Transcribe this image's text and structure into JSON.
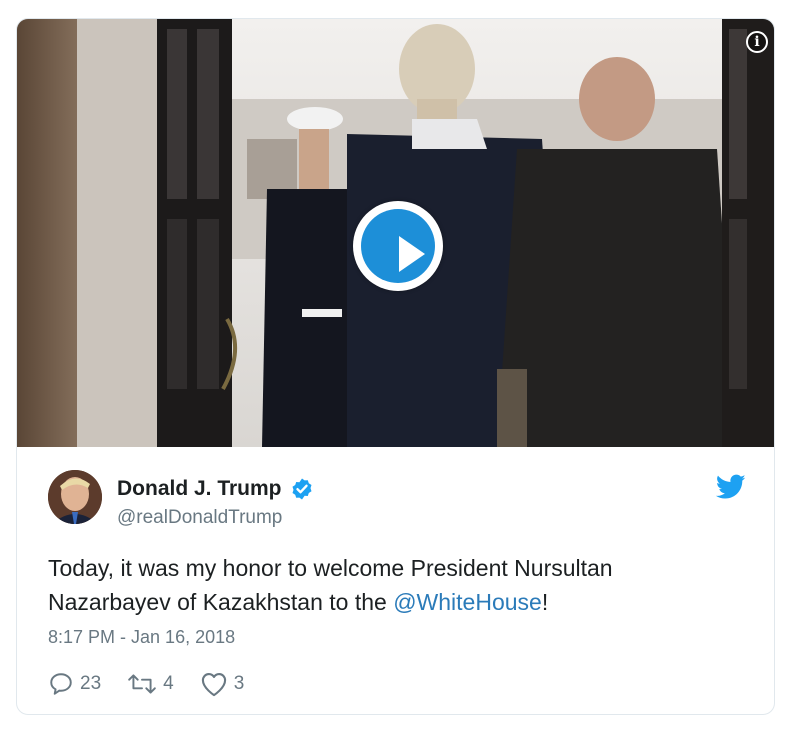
{
  "media": {
    "info_glyph": "i",
    "play_icon": "play-icon",
    "play_color": "#1d8fd8"
  },
  "tweet": {
    "display_name": "Donald J. Trump",
    "handle": "@realDonaldTrump",
    "verified_icon": "verified-badge-icon",
    "verified_color": "#1da1f2",
    "brand_icon": "twitter-bird-icon",
    "brand_color": "#1da1f2",
    "text_before": "Today, it was my honor to welcome President Nursultan Nazarbayev of Kazakhstan to the ",
    "mention": "@WhiteHouse",
    "text_after": "!",
    "timestamp": "8:17 PM - Jan 16, 2018"
  },
  "actions": {
    "reply_count": "23",
    "retweet_count": "4",
    "like_count": "3"
  }
}
